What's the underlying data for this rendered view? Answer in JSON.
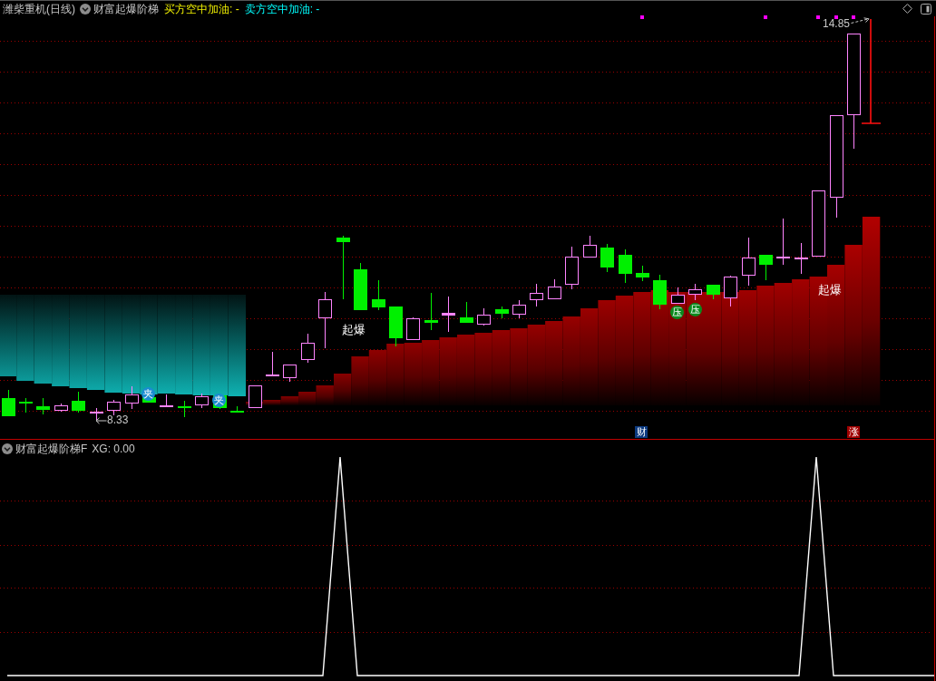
{
  "header": {
    "title": "潍柴重机(日线)",
    "indicator": "财富起爆阶梯",
    "readouts": [
      {
        "kind": "buy",
        "text": "买方空中加油: -"
      },
      {
        "kind": "sell",
        "text": "卖方空中加油: -"
      }
    ]
  },
  "main_chart": {
    "high_label": "14.85",
    "low_label": "8.33",
    "signals": [
      "起爆",
      "起爆"
    ],
    "badges": [
      {
        "text": "夹",
        "color": "#1a8cd0"
      },
      {
        "text": "夹",
        "color": "#1a8cd0"
      },
      {
        "text": "压",
        "color": "#0a8a1e"
      },
      {
        "text": "压",
        "color": "#0a8a1e"
      }
    ],
    "markers": [
      {
        "text": "财",
        "color": "#0c3a80"
      },
      {
        "text": "涨",
        "color": "#a00000"
      }
    ]
  },
  "sub_chart": {
    "indicator": "财富起爆阶梯F",
    "reading": "XG: 0.00"
  }
}
